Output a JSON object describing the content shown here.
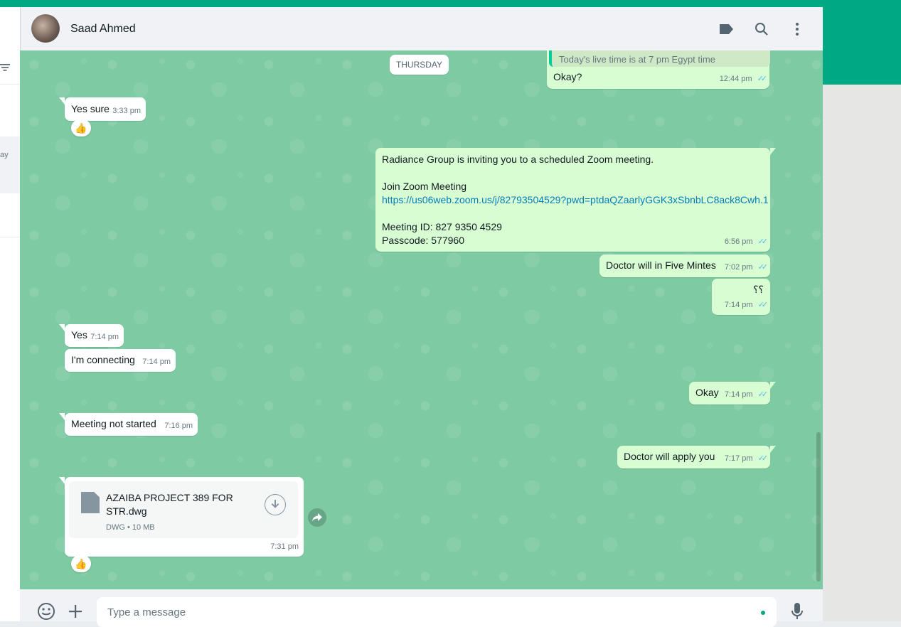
{
  "contact": {
    "name": "Saad Ahmed"
  },
  "sidebar": {
    "preview_text": "ay"
  },
  "date_separator": "THURSDAY",
  "messages": {
    "m0": {
      "quote": "Today's live time is at  7 pm Egypt time",
      "text": "Okay?",
      "time": "12:44 pm"
    },
    "m1": {
      "text": "Yes sure",
      "time": "3:33 pm",
      "reaction": "👍"
    },
    "m2": {
      "line1": "Radiance Group is inviting you to a scheduled Zoom meeting.",
      "line2": "Join Zoom Meeting",
      "link": "https://us06web.zoom.us/j/82793504529?pwd=ptdaQZaarlyGGK3xSbnbLC8ack8Cwh.1",
      "line3": "Meeting ID: 827 9350 4529",
      "line4": "Passcode: 577960",
      "time": "6:56 pm"
    },
    "m3": {
      "text": "Doctor will in Five Mintes",
      "time": "7:02 pm"
    },
    "m4": {
      "text": "؟؟",
      "time": "7:14 pm"
    },
    "m5": {
      "text": "Yes",
      "time": "7:14 pm"
    },
    "m6": {
      "text": "I'm connecting",
      "time": "7:14 pm"
    },
    "m7": {
      "text": "Okay",
      "time": "7:14 pm"
    },
    "m8": {
      "text": "Meeting not started",
      "time": "7:16 pm"
    },
    "m9": {
      "text": "Doctor will apply you",
      "time": "7:17 pm"
    },
    "m10": {
      "file_name": "AZAIBA PROJECT 389 FOR STR.dwg",
      "file_meta": "DWG • 10 MB",
      "time": "7:31 pm",
      "reaction": "👍"
    }
  },
  "composer": {
    "placeholder": "Type a message"
  },
  "colors": {
    "accent": "#00a884",
    "outgoing": "#d9fdd3",
    "incoming": "#ffffff",
    "read_ticks": "#53bdeb"
  }
}
